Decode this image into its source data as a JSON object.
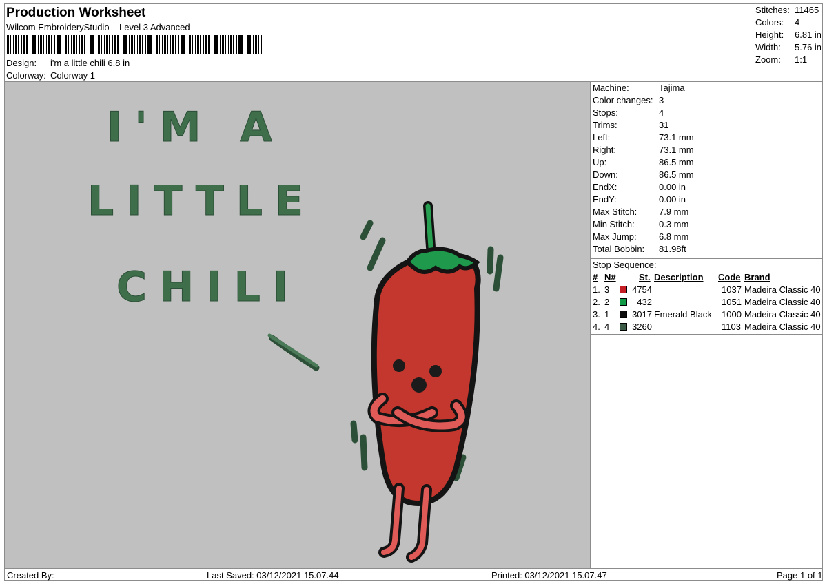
{
  "header": {
    "title": "Production Worksheet",
    "software": "Wilcom EmbroideryStudio – Level 3 Advanced",
    "design_label": "Design:",
    "design_value": "i'm a little chili 6,8 in",
    "colorway_label": "Colorway:",
    "colorway_value": "Colorway 1"
  },
  "stats": [
    {
      "label": "Stitches:",
      "value": "11465"
    },
    {
      "label": "Colors:",
      "value": "4"
    },
    {
      "label": "Height:",
      "value": "6.81 in"
    },
    {
      "label": "Width:",
      "value": "5.76 in"
    },
    {
      "label": "Zoom:",
      "value": "1:1"
    }
  ],
  "machine_info": [
    {
      "label": "Machine:",
      "value": "Tajima"
    },
    {
      "label": "Color changes:",
      "value": "3"
    },
    {
      "label": "Stops:",
      "value": "4"
    },
    {
      "label": "Trims:",
      "value": "31"
    },
    {
      "label": "Left:",
      "value": "73.1 mm"
    },
    {
      "label": "Right:",
      "value": "73.1 mm"
    },
    {
      "label": "Up:",
      "value": "86.5 mm"
    },
    {
      "label": "Down:",
      "value": "86.5 mm"
    },
    {
      "label": "EndX:",
      "value": "0.00 in"
    },
    {
      "label": "EndY:",
      "value": "0.00 in"
    },
    {
      "label": "Max Stitch:",
      "value": "7.9 mm"
    },
    {
      "label": "Min Stitch:",
      "value": "0.3 mm"
    },
    {
      "label": "Max Jump:",
      "value": "6.8 mm"
    },
    {
      "label": "Total Bobbin:",
      "value": "81.98ft"
    }
  ],
  "stop_sequence": {
    "title": "Stop Sequence:",
    "columns": {
      "num": "#",
      "n": "N#",
      "st": "St.",
      "desc": "Description",
      "code": "Code",
      "brand": "Brand"
    },
    "rows": [
      {
        "num": "1.",
        "n": "3",
        "color": "#c41e24",
        "st": "4754",
        "desc": "",
        "code": "1037",
        "brand": "Madeira Classic 40"
      },
      {
        "num": "2.",
        "n": "2",
        "color": "#119a46",
        "st": "432",
        "desc": "",
        "code": "1051",
        "brand": "Madeira Classic 40"
      },
      {
        "num": "3.",
        "n": "1",
        "color": "#0c0c0c",
        "st": "3017",
        "desc": "Emerald Black",
        "code": "1000",
        "brand": "Madeira Classic 40"
      },
      {
        "num": "4.",
        "n": "4",
        "color": "#3a5a45",
        "st": "3260",
        "desc": "",
        "code": "1103",
        "brand": "Madeira Classic 40"
      }
    ]
  },
  "design_text": {
    "line1": "I'M A",
    "line2": "LITTLE",
    "line3": "CHILI"
  },
  "footer": {
    "created_by": "Created By:",
    "last_saved": "Last Saved: 03/12/2021 15.07.44",
    "printed": "Printed: 03/12/2021 15.07.47",
    "page": "Page 1 of 1"
  }
}
